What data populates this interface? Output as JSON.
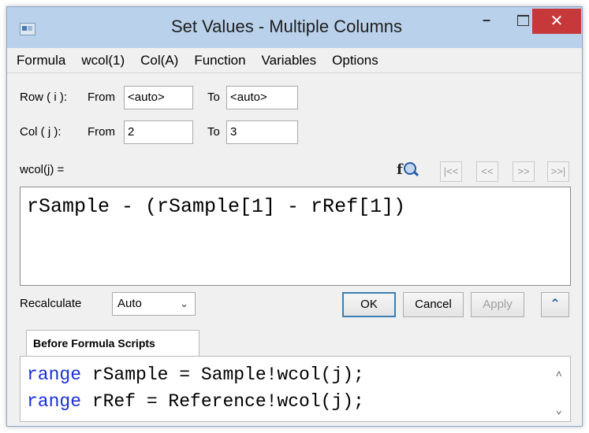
{
  "window": {
    "title": "Set Values - Multiple Columns",
    "minimize": "–",
    "close": "✕"
  },
  "menu": [
    "Formula",
    "wcol(1)",
    "Col(A)",
    "Function",
    "Variables",
    "Options"
  ],
  "row": {
    "label": "Row ( i ):",
    "from_label": "From",
    "from_value": "<auto>",
    "to_label": "To",
    "to_value": "<auto>"
  },
  "col": {
    "label": "Col  ( j ):",
    "from_label": "From",
    "from_value": "2",
    "to_label": "To",
    "to_value": "3"
  },
  "formula": {
    "label": "wcol(j) =",
    "fx_glyph": "f",
    "text": "rSample - (rSample[1] - rRef[1])"
  },
  "nav": {
    "first": "|<<",
    "prev": "<<",
    "next": ">>",
    "last": ">>|"
  },
  "recalculate": {
    "label": "Recalculate",
    "value": "Auto",
    "chevron": "⌄"
  },
  "buttons": {
    "ok": "OK",
    "cancel": "Cancel",
    "apply": "Apply",
    "collapse": "⌃"
  },
  "scripts": {
    "tab_label": "Before Formula Scripts",
    "lines": [
      {
        "keyword": "range",
        "rest": " rSample = Sample!wcol(j);"
      },
      {
        "keyword": "range",
        "rest": " rRef = Reference!wcol(j);"
      }
    ],
    "scroll_up": "^",
    "scroll_down": "⌄"
  },
  "colors": {
    "titlebar": "#b9d1ea",
    "close_button": "#c7383a",
    "keyword": "#1a2fd6",
    "ok_border": "#3c7fb1"
  }
}
